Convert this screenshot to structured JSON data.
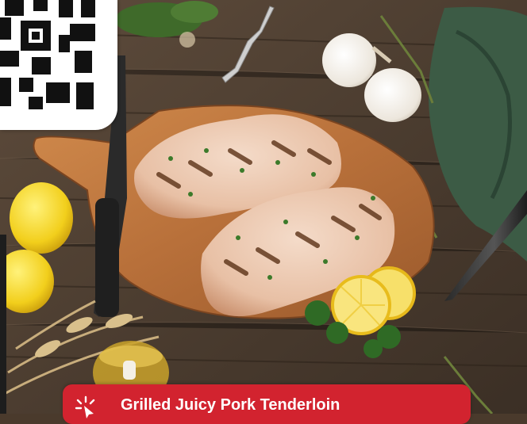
{
  "recipe": {
    "title": "Grilled Juicy Pork Tenderloin",
    "accent_color": "#d2232f",
    "icon": "sparkle-cursor-icon"
  },
  "photo": {
    "subject": "grilled pork tenderloin on wooden cutting board with lemons, garlic, herbs and wheat"
  },
  "qr_code": {
    "icon": "qr-code-icon"
  }
}
